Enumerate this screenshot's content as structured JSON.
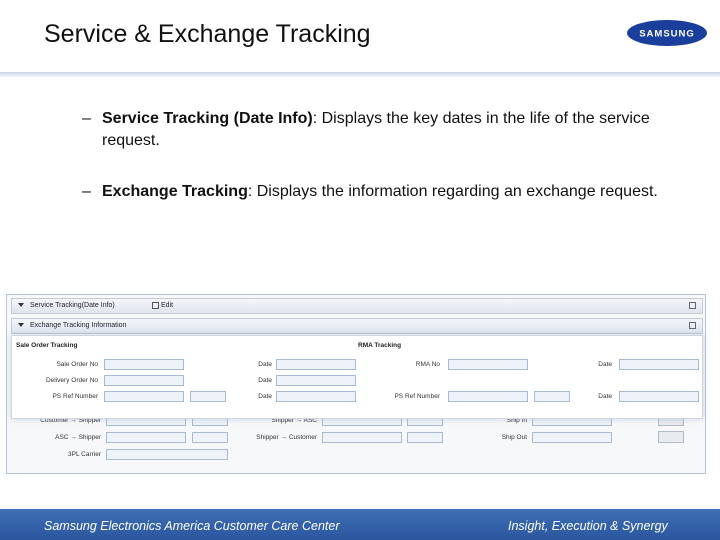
{
  "slide": {
    "title": "Service & Exchange Tracking",
    "logo_text": "SAMSUNG",
    "brand_color": "#1a3e9c",
    "footer_color": "#2f5fa8"
  },
  "bullets": [
    {
      "dash": "–",
      "bold": "Service Tracking (Date Info)",
      "rest": ": Displays the key dates in the life of the service request."
    },
    {
      "dash": "–",
      "bold": "Exchange Tracking",
      "rest": ": Displays the information regarding an exchange request."
    }
  ],
  "screenshot": {
    "panel1_title": "Service Tracking(Date Info)",
    "panel1_action": "Edit",
    "panel2_title": "Exchange Tracking Information",
    "sale_order_heading": "Sale Order Tracking",
    "rma_heading": "RMA Tracking",
    "rows": [
      {
        "l1": "Sale Order No",
        "l2": "Date",
        "l3": "RMA No",
        "l4": "Date"
      },
      {
        "l1": "Delivery Order No",
        "l2": "Date"
      },
      {
        "l1": "PS Ref Number",
        "l2": "Date",
        "l3": "PS Ref Number",
        "l4": "Date"
      }
    ],
    "lower_rows": [
      {
        "l1": "Customer → Shipper",
        "l2": "Shipper → ASC",
        "l3": "Ship In"
      },
      {
        "l1": "ASC → Shipper",
        "l2": "Shipper → Customer",
        "l3": "Ship Out"
      },
      {
        "l1": "3PL Carrier"
      }
    ]
  },
  "footer": {
    "left": "Samsung Electronics America Customer Care Center",
    "right": "Insight, Execution & Synergy"
  }
}
